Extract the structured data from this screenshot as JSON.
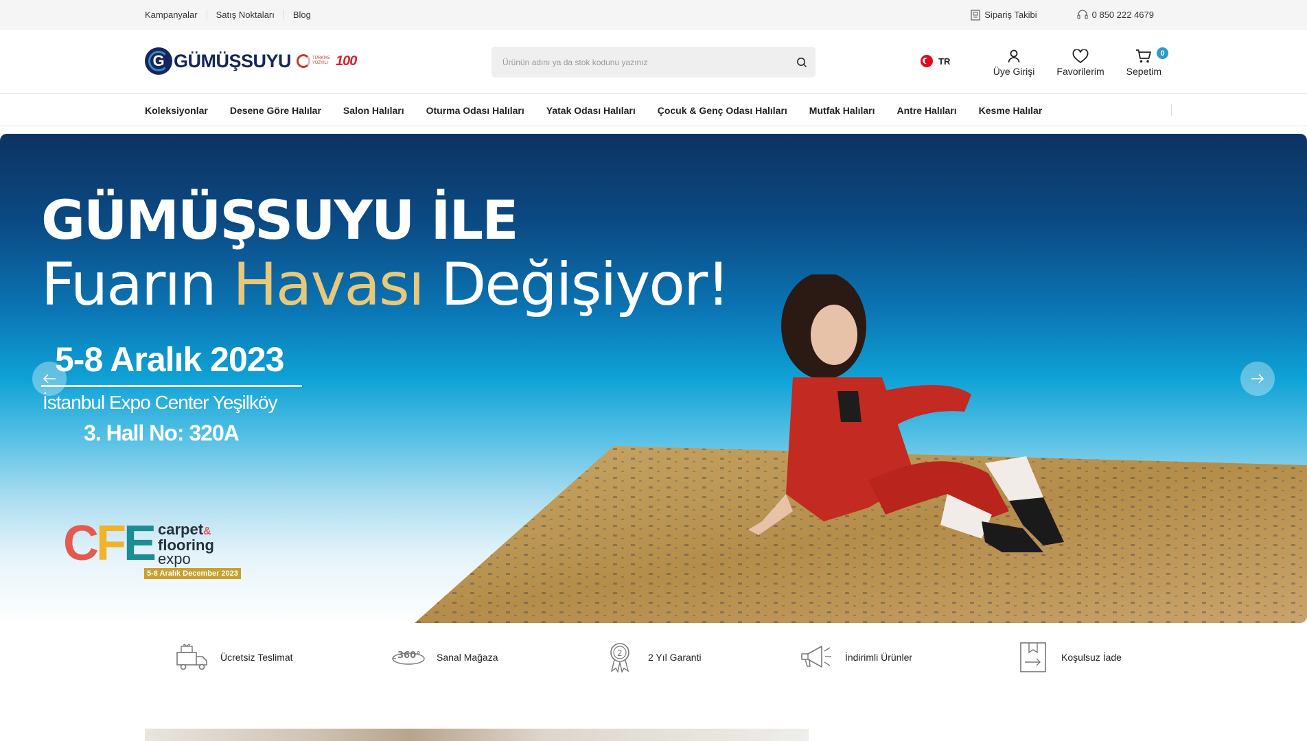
{
  "topbar": {
    "links": [
      "Kampanyalar",
      "Satış Noktaları",
      "Blog"
    ],
    "order_tracking": "Sipariş Takibi",
    "phone": "0 850 222 4679"
  },
  "header": {
    "logo_text": "GÜMÜŞSUYU",
    "logo_mark": "G",
    "search_placeholder": "Ürünün adını ya da stok kodunu yazınız",
    "language": "TR",
    "login_label": "Üye Girişi",
    "favorites_label": "Favorilerim",
    "cart_label": "Sepetim",
    "cart_count": "0"
  },
  "nav": {
    "items": [
      "Koleksiyonlar",
      "Desene Göre Halılar",
      "Salon Halıları",
      "Oturma Odası Halıları",
      "Yatak Odası Halıları",
      "Çocuk & Genç Odası Halıları",
      "Mutfak Halıları",
      "Antre Halıları",
      "Kesme Halılar"
    ]
  },
  "hero": {
    "line1": "GÜMÜŞSUYU İLE",
    "line2_a": "Fuarın ",
    "line2_gold": "Havası",
    "line2_b": " Değişiyor!",
    "date": "5-8 Aralık 2023",
    "venue": "İstanbul Expo Center Yeşilköy",
    "hall": "3. Hall No: 320A",
    "cfe_c": "C",
    "cfe_f": "F",
    "cfe_e": "E",
    "cfe_carpet": "carpet",
    "cfe_amp": "&",
    "cfe_flooring": "flooring",
    "cfe_expo": "expo",
    "cfe_ribbon": "5-8 Aralık December 2023"
  },
  "features": [
    {
      "label": "Ücretsiz Teslimat",
      "icon": "delivery-truck-icon"
    },
    {
      "label": "Sanal Mağaza",
      "icon": "360-view-icon"
    },
    {
      "label": "2 Yıl Garanti",
      "icon": "warranty-badge-icon"
    },
    {
      "label": "İndirimli Ürünler",
      "icon": "megaphone-icon"
    },
    {
      "label": "Koşulsuz İade",
      "icon": "return-box-icon"
    }
  ],
  "colors": {
    "brand_navy": "#14265c",
    "accent_blue": "#2a9cc7",
    "gold": "#e8c87a"
  }
}
